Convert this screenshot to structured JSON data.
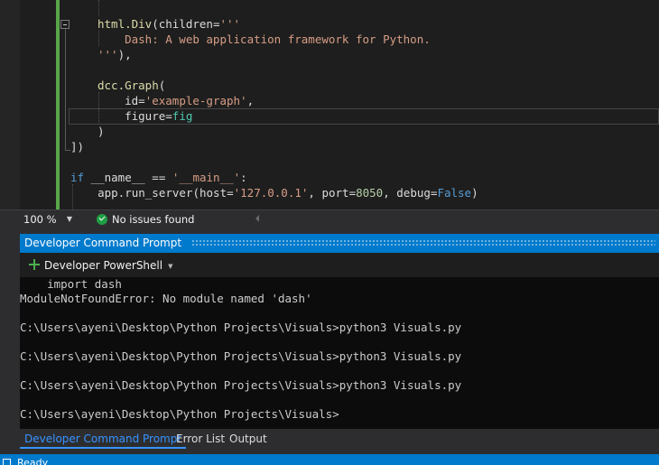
{
  "editor": {
    "lines": [
      {
        "tokens": [
          {
            "t": "html.Div",
            "c": "fn"
          },
          {
            "t": "(children=",
            "c": "txt"
          },
          {
            "t": "'''",
            "c": "str"
          }
        ]
      },
      {
        "tokens": [
          {
            "t": "    Dash: A web application framework for Python.",
            "c": "str"
          }
        ]
      },
      {
        "tokens": [
          {
            "t": "'''",
            "c": "str"
          },
          {
            "t": "),",
            "c": "txt"
          }
        ]
      },
      {
        "tokens": []
      },
      {
        "tokens": [
          {
            "t": "dcc.Graph",
            "c": "fn"
          },
          {
            "t": "(",
            "c": "txt"
          }
        ]
      },
      {
        "tokens": [
          {
            "t": "    id=",
            "c": "txt"
          },
          {
            "t": "'example-graph'",
            "c": "str"
          },
          {
            "t": ",",
            "c": "txt"
          }
        ]
      },
      {
        "tokens": [
          {
            "t": "    figure=",
            "c": "txt"
          },
          {
            "t": "fig",
            "c": "cls"
          }
        ]
      },
      {
        "tokens": [
          {
            "t": ")",
            "c": "txt"
          }
        ]
      },
      {
        "tokens": [
          {
            "t": "])",
            "c": "txt"
          }
        ]
      },
      {
        "tokens": []
      },
      {
        "tokens": [
          {
            "t": "if ",
            "c": "kw"
          },
          {
            "t": "__name__ == ",
            "c": "txt"
          },
          {
            "t": "'__main__'",
            "c": "str"
          },
          {
            "t": ":",
            "c": "txt"
          }
        ]
      },
      {
        "tokens": [
          {
            "t": "    app.run_server(host=",
            "c": "txt"
          },
          {
            "t": "'127.0.0.1'",
            "c": "str"
          },
          {
            "t": ", port=",
            "c": "txt"
          },
          {
            "t": "8050",
            "c": "num"
          },
          {
            "t": ", debug=",
            "c": "txt"
          },
          {
            "t": "False",
            "c": "kw"
          },
          {
            "t": ")",
            "c": "txt"
          }
        ]
      }
    ]
  },
  "editor_status": {
    "zoom": "100 %",
    "issues": "No issues found"
  },
  "panel": {
    "title": "Developer Command Prompt",
    "profile": "Developer PowerShell",
    "terminal_lines": [
      "    import dash",
      "ModuleNotFoundError: No module named 'dash'",
      "",
      "C:\\Users\\ayeni\\Desktop\\Python Projects\\Visuals>python3 Visuals.py",
      "",
      "C:\\Users\\ayeni\\Desktop\\Python Projects\\Visuals>python3 Visuals.py",
      "",
      "C:\\Users\\ayeni\\Desktop\\Python Projects\\Visuals>python3 Visuals.py",
      "",
      "C:\\Users\\ayeni\\Desktop\\Python Projects\\Visuals>"
    ]
  },
  "tabs": [
    {
      "label": "Developer Command Prompt",
      "active": true
    },
    {
      "label": "Error List",
      "active": false
    },
    {
      "label": "Output",
      "active": false
    }
  ],
  "status": {
    "text": "Ready"
  },
  "colors": {
    "accent": "#007acc",
    "success": "#1e9e44",
    "active_tab": "#3794ff"
  }
}
